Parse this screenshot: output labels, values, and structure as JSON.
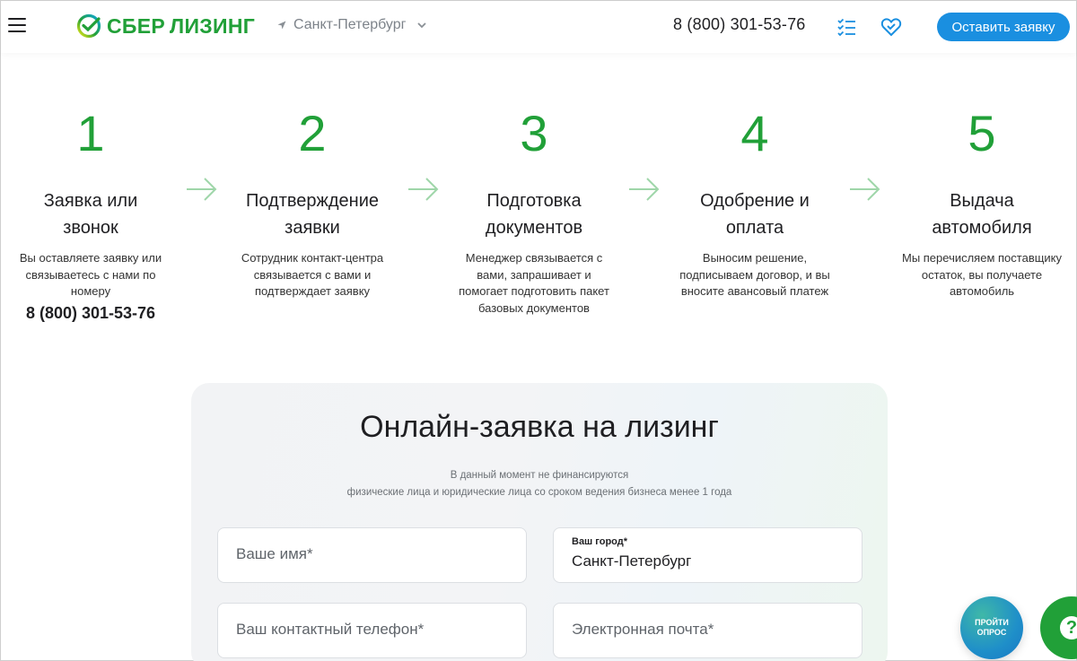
{
  "header": {
    "logo_sber": "СБЕР",
    "logo_lz": "ЛИЗИНГ",
    "city": "Санкт-Петербург",
    "phone": "8 (800) 301-53-76",
    "cta_label": "Оставить заявку",
    "icons": [
      "menu-icon",
      "location-arrow-icon",
      "chevron-down-icon",
      "compare-list-icon",
      "heart-icon"
    ]
  },
  "steps": [
    {
      "num": "1",
      "title_l1": "Заявка или",
      "title_l2": "звонок",
      "desc_l1": "Вы оставляете заявку или",
      "desc_l2": "связываетесь с нами по",
      "desc_l3": "номеру",
      "phone": "8 (800) 301-53-76"
    },
    {
      "num": "2",
      "title_l1": "Подтверждение",
      "title_l2": "заявки",
      "desc_l1": "Сотрудник контакт-центра",
      "desc_l2": "связывается с вами и",
      "desc_l3": "подтверждает заявку"
    },
    {
      "num": "3",
      "title_l1": "Подготовка",
      "title_l2": "документов",
      "desc_l1": "Менеджер связывается с",
      "desc_l2": "вами, запрашивает и",
      "desc_l3": "помогает подготовить пакет",
      "desc_l4": "базовых документов"
    },
    {
      "num": "4",
      "title_l1": "Одобрение и",
      "title_l2": "оплата",
      "desc_l1": "Выносим решение,",
      "desc_l2": "подписываем договор, и вы",
      "desc_l3": "вносите авансовый платеж"
    },
    {
      "num": "5",
      "title_l1": "Выдача",
      "title_l2": "автомобиля",
      "desc_l1": "Мы перечисляем поставщику",
      "desc_l2": "остаток, вы получаете",
      "desc_l3": "автомобиль"
    }
  ],
  "form": {
    "title": "Онлайн-заявка на лизинг",
    "note_l1": "В данный момент не финансируются",
    "note_l2": "физические лица и юридические лица со сроком ведения бизнеса менее 1 года",
    "name_placeholder": "Ваше имя*",
    "city_label": "Ваш город*",
    "city_value": "Санкт-Петербург",
    "phone_placeholder": "Ваш контактный телефон*",
    "email_placeholder": "Электронная почта*"
  },
  "floating": {
    "survey_l1": "ПРОЙТИ",
    "survey_l2": "ОПРОС",
    "help": "?"
  },
  "colors": {
    "brand_green": "#21a038",
    "cta_blue": "#1a8fe0"
  }
}
